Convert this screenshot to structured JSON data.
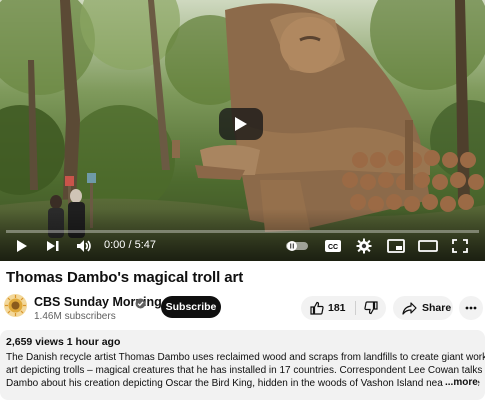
{
  "player": {
    "time": "0:00 / 5:47",
    "play_progress": 0.0
  },
  "video": {
    "title": "Thomas Dambo's magical troll art"
  },
  "channel": {
    "name": "CBS Sunday Morning",
    "subscribers": "1.46M subscribers",
    "verified": true
  },
  "actions": {
    "subscribe_label": "Subscribe",
    "like_count": "181",
    "share_label": "Share"
  },
  "description": {
    "views_time": "2,659 views  1 hour ago",
    "line1": "The Danish recycle artist Thomas Dambo uses reclaimed wood and scraps from landfills to create giant works of",
    "line2": "art depicting trolls – magical creatures that he has installed in 17 countries. Correspondent Lee Cowan talks with",
    "line3": "Dambo about his creation depicting Oscar the Bird King, hidden in the woods of Vashon Island near Seattle",
    "more_label": "...more"
  },
  "colors": {
    "subscribe_bg": "#0f0f0f",
    "pill_bg": "#f2f2f2",
    "desc_bg": "#f2f2f2",
    "secondary_text": "#606060"
  },
  "icons": [
    "play-icon",
    "next-icon",
    "volume-icon",
    "autoplay-toggle-icon",
    "captions-icon",
    "settings-icon",
    "miniplayer-icon",
    "theater-icon",
    "fullscreen-icon",
    "verified-icon",
    "thumbs-up-icon",
    "thumbs-down-icon",
    "share-icon",
    "more-icon"
  ]
}
